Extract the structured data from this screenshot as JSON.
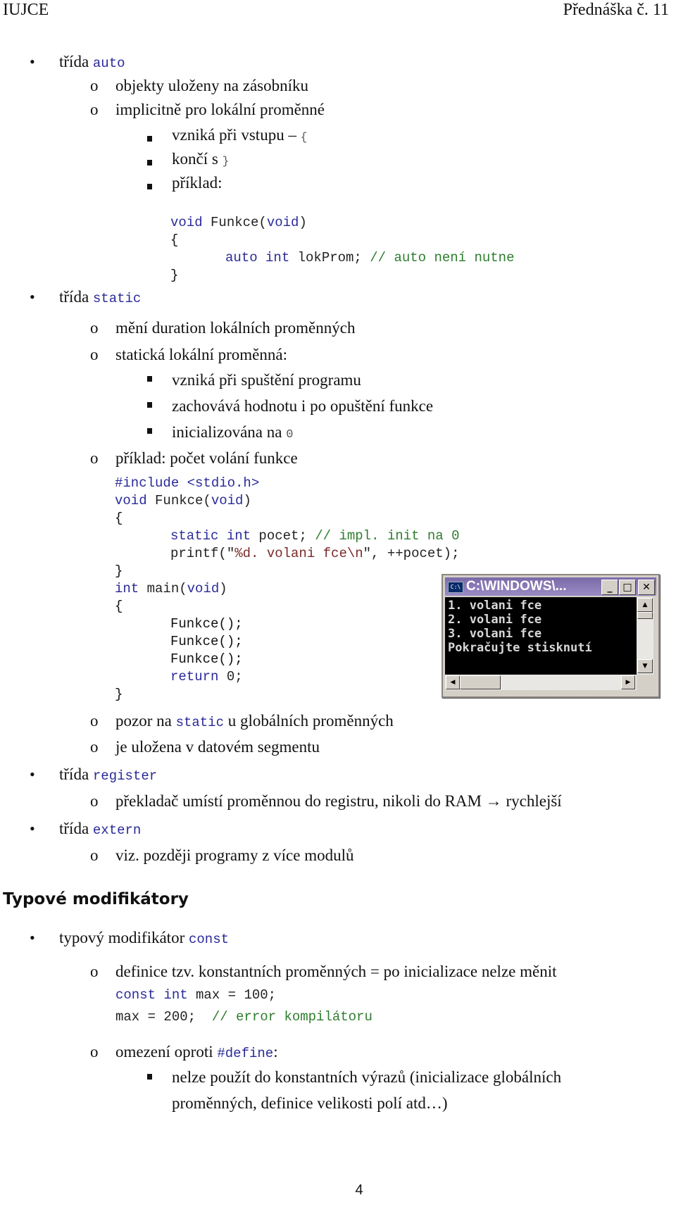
{
  "header": {
    "left": "IUJCE",
    "right": "Přednáška č. 11"
  },
  "bullets": {
    "l1": "•",
    "l2": "o"
  },
  "sections": {
    "auto": {
      "prefix": "třída ",
      "keyword": "auto",
      "items": [
        "objekty uloženy na zásobníku",
        "implicitně pro lokální proměnné"
      ],
      "sub": {
        "enter_text": "vzniká při vstupu – ",
        "enter_code": "{",
        "end_text": "končí s ",
        "end_code": "}",
        "example": "příklad:"
      },
      "code": {
        "l1_kw": "void",
        "l1_name": " Funkce(",
        "l1_kw2": "void",
        "l1_close": ")",
        "l2": "{",
        "l3_kw": "auto int",
        "l3_rest": " lokProm; ",
        "l3_cm": "// auto není nutne",
        "l4": "}"
      }
    },
    "static": {
      "prefix": "třída ",
      "keyword": "static",
      "items": [
        "mění duration lokálních proměnných",
        "statická lokální proměnná:"
      ],
      "sub": [
        "vzniká při spuštění programu",
        "zachovává hodnotu i po opuštění funkce",
        "inicializována na "
      ],
      "sub_code": "0",
      "example": "příklad: počet volání funkce",
      "code": {
        "include": "#include <stdio.h>",
        "f_kw": "void",
        "f_name": " Funkce(",
        "f_kw2": "void",
        "f_close": ")",
        "open": "{",
        "s_kw": "static int",
        "s_rest": " pocet; ",
        "s_cm": "// impl. init na 0",
        "p_a": "printf(\"",
        "p_str": "%d. volani fce\\n",
        "p_b": "\", ++pocet);",
        "close": "}",
        "m_kw": "int",
        "m_name": " main(",
        "m_kw2": "void",
        "m_close": ")",
        "m_open": "{",
        "calls": [
          "Funkce();",
          "Funkce();",
          "Funkce();"
        ],
        "ret_kw": "return",
        "ret_rest": " 0;",
        "m_close_brace": "}"
      },
      "after": {
        "warn_a": "pozor na ",
        "warn_code": "static",
        "warn_b": " u globálních proměnných",
        "segment": "je uložena v datovém segmentu"
      }
    },
    "register": {
      "prefix": "třída ",
      "keyword": "register",
      "item": "překladač umístí proměnnou do registru, nikoli do RAM → rychlejší"
    },
    "extern": {
      "prefix": "třída ",
      "keyword": "extern",
      "item": "viz. později programy z více modulů"
    }
  },
  "console": {
    "icon": "C:\\",
    "title": "C:\\WINDOWS\\...",
    "buttons": {
      "minimize": "_",
      "maximize": "□",
      "close": "✕"
    },
    "lines": [
      "1. volani fce",
      "2. volani fce",
      "3. volani fce",
      "Pokračujte stisknutí"
    ],
    "scroll_up": "▲",
    "scroll_down": "▼",
    "scroll_left": "◀",
    "scroll_right": "▶"
  },
  "modifiers": {
    "heading": "Typové modifikátory",
    "const_prefix": "typový modifikátor ",
    "const_kw": "const",
    "def": "definice tzv. konstantních proměnných = po inicializace nelze měnit",
    "code1_kw": "const int",
    "code1_rest": " max = 100;",
    "code2_rest": "max = 200;  ",
    "code2_cm": "// error kompilátoru",
    "limit_a": "omezení oproti ",
    "limit_code": "#define",
    "limit_b": ":",
    "limit_item_l1": "nelze použít do konstantních výrazů (inicializace globálních",
    "limit_item_l2": "proměnných, definice velikosti polí atd…)"
  },
  "footer": {
    "page": "4"
  }
}
